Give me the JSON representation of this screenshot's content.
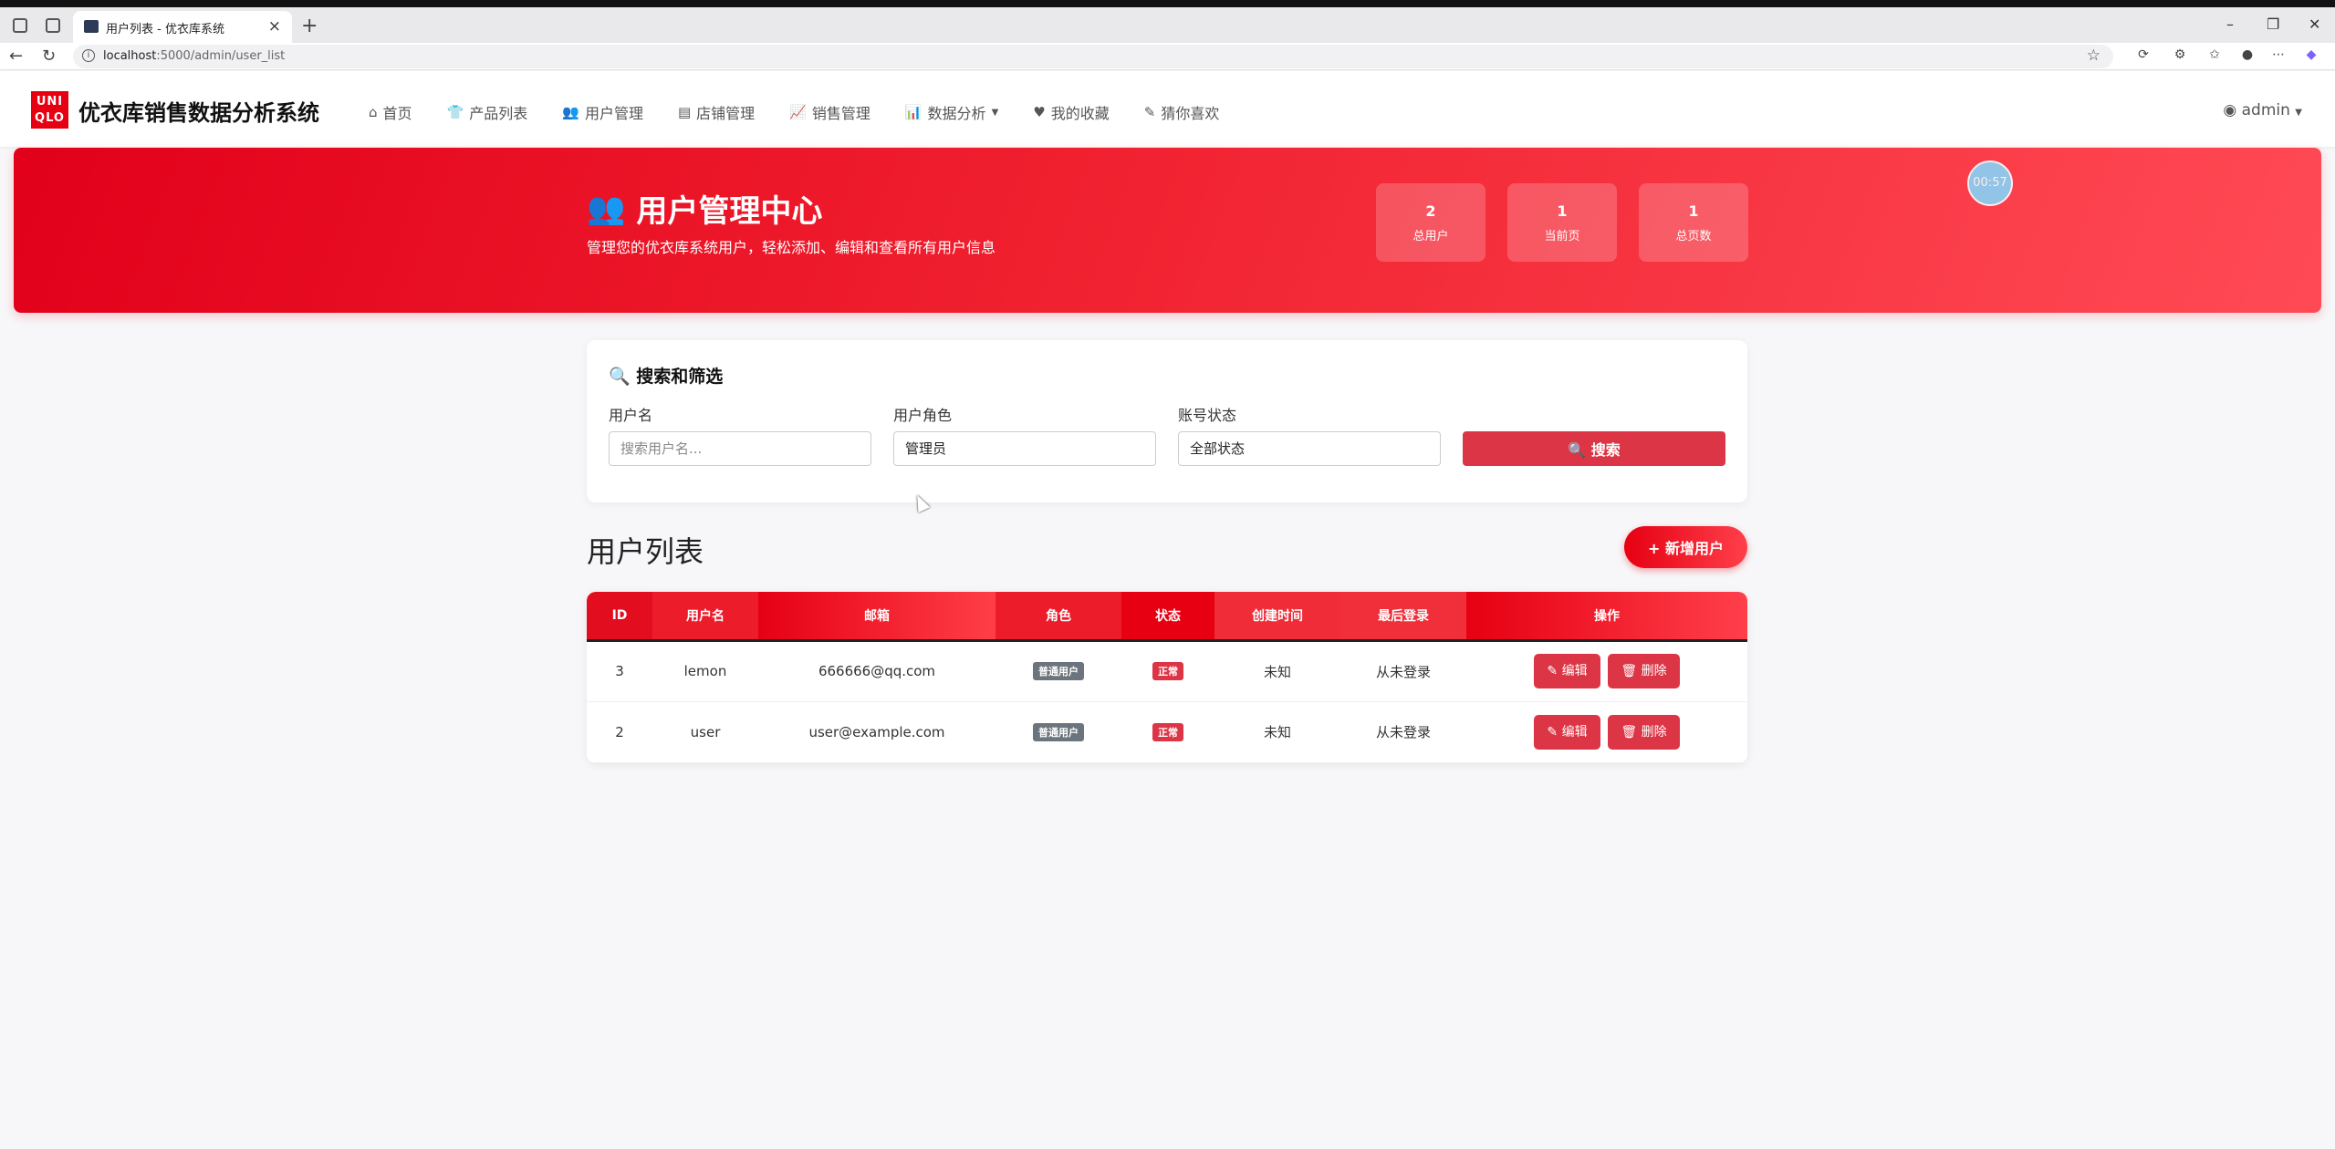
{
  "browser": {
    "tab_title": "用户列表 - 优衣库系统",
    "url_host": "localhost",
    "url_rest": ":5000/admin/user_list"
  },
  "navbar": {
    "logo_line1": "UNI",
    "logo_line2": "QLO",
    "brand": "优衣库销售数据分析系统",
    "menu": [
      {
        "icon": "home-icon",
        "label": "首页"
      },
      {
        "icon": "shirt-icon",
        "label": "产品列表"
      },
      {
        "icon": "users-icon",
        "label": "用户管理"
      },
      {
        "icon": "store-icon",
        "label": "店铺管理"
      },
      {
        "icon": "line-chart-icon",
        "label": "销售管理"
      },
      {
        "icon": "bar-chart-icon",
        "label": "数据分析"
      },
      {
        "icon": "heart-icon",
        "label": "我的收藏"
      },
      {
        "icon": "pencil-icon",
        "label": "猜你喜欢"
      }
    ],
    "user": "admin"
  },
  "hero": {
    "title": "用户管理中心",
    "subtitle": "管理您的优衣库系统用户，轻松添加、编辑和查看所有用户信息",
    "stats": [
      {
        "value": "2",
        "label": "总用户"
      },
      {
        "value": "1",
        "label": "当前页"
      },
      {
        "value": "1",
        "label": "总页数"
      }
    ],
    "timer": "00:57"
  },
  "search": {
    "title": "搜索和筛选",
    "username_label": "用户名",
    "username_placeholder": "搜索用户名...",
    "role_label": "用户角色",
    "role_value": "管理员",
    "status_label": "账号状态",
    "status_value": "全部状态",
    "button": "搜索"
  },
  "list": {
    "title": "用户列表",
    "add_button": "新增用户",
    "columns": [
      "ID",
      "用户名",
      "邮箱",
      "角色",
      "状态",
      "创建时间",
      "最后登录",
      "操作"
    ],
    "rows": [
      {
        "id": "3",
        "username": "lemon",
        "email": "666666@qq.com",
        "role": "普通用户",
        "status": "正常",
        "created": "未知",
        "last_login": "从未登录",
        "edit": "编辑",
        "delete": "删除"
      },
      {
        "id": "2",
        "username": "user",
        "email": "user@example.com",
        "role": "普通用户",
        "status": "正常",
        "created": "未知",
        "last_login": "从未登录",
        "edit": "编辑",
        "delete": "删除"
      }
    ]
  },
  "colors": {
    "brand_red": "#e60012",
    "danger": "#dc3545",
    "role_badge": "#6c757d"
  }
}
